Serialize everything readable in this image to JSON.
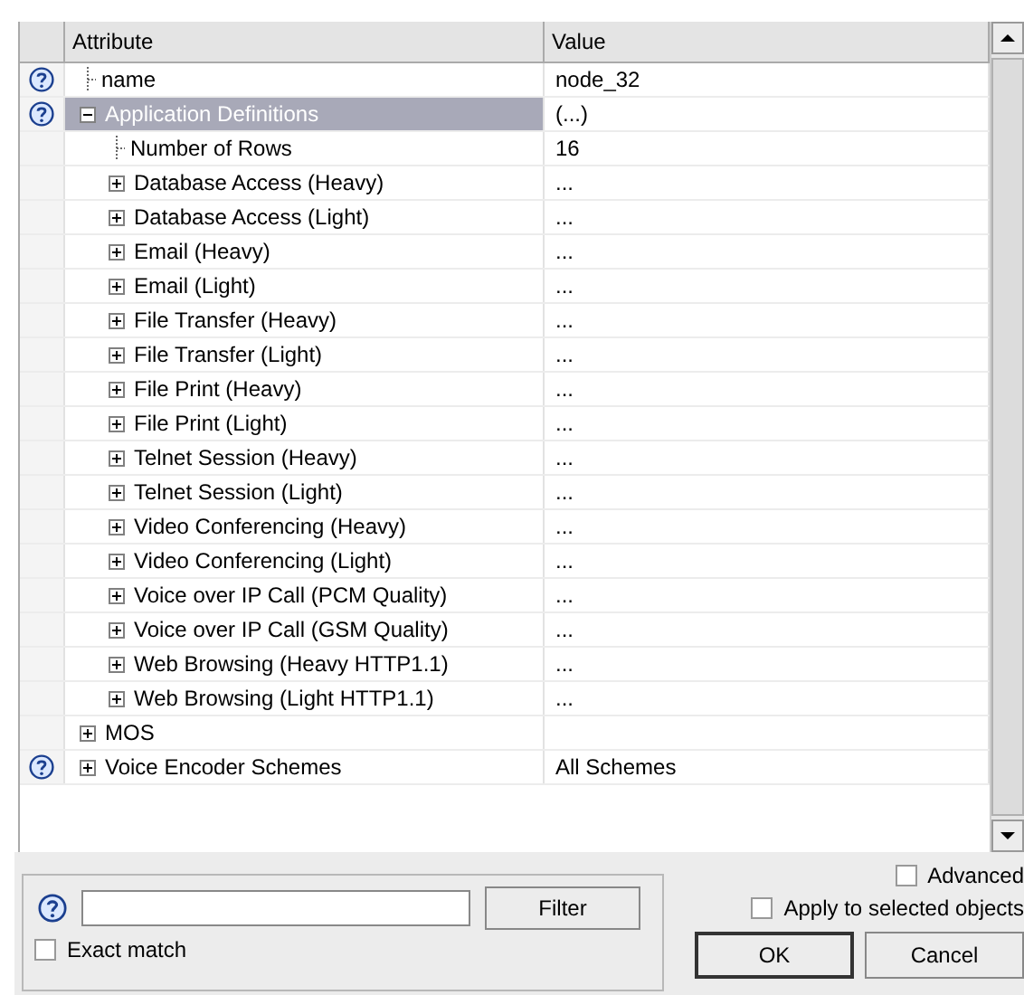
{
  "table": {
    "columns": [
      "Attribute",
      "Value"
    ],
    "rows": [
      {
        "name": "name",
        "value": "node_32",
        "help": true,
        "selected": false
      },
      {
        "name": "Application Definitions",
        "value": "(...)",
        "help": true,
        "selected": true,
        "expanded": true,
        "children": [
          {
            "name": "Number of Rows",
            "value": "16",
            "selected": false
          },
          {
            "name": "Database Access (Heavy)",
            "value": "...",
            "selected": false,
            "expanded": false
          },
          {
            "name": "Database Access (Light)",
            "value": "...",
            "selected": false,
            "expanded": false
          },
          {
            "name": "Email (Heavy)",
            "value": "...",
            "selected": false,
            "expanded": false
          },
          {
            "name": "Email (Light)",
            "value": "...",
            "selected": false,
            "expanded": false
          },
          {
            "name": "File Transfer (Heavy)",
            "value": "...",
            "selected": false,
            "expanded": false
          },
          {
            "name": "File Transfer (Light)",
            "value": "...",
            "selected": false,
            "expanded": false
          },
          {
            "name": "File Print (Heavy)",
            "value": "...",
            "selected": false,
            "expanded": false
          },
          {
            "name": "File Print (Light)",
            "value": "...",
            "selected": false,
            "expanded": false
          },
          {
            "name": "Telnet Session (Heavy)",
            "value": "...",
            "selected": false,
            "expanded": false
          },
          {
            "name": "Telnet Session (Light)",
            "value": "...",
            "selected": false,
            "expanded": false
          },
          {
            "name": "Video Conferencing (Heavy)",
            "value": "...",
            "selected": false,
            "expanded": false
          },
          {
            "name": "Video Conferencing (Light)",
            "value": "...",
            "selected": false,
            "expanded": false
          },
          {
            "name": "Voice over IP Call (PCM Quality)",
            "value": "...",
            "selected": false,
            "expanded": false
          },
          {
            "name": "Voice over IP Call (GSM Quality)",
            "value": "...",
            "selected": false,
            "expanded": false
          },
          {
            "name": "Web Browsing (Heavy HTTP1.1)",
            "value": "...",
            "selected": false,
            "expanded": false
          },
          {
            "name": "Web Browsing (Light HTTP1.1)",
            "value": "...",
            "selected": false,
            "expanded": false
          }
        ]
      },
      {
        "name": "MOS",
        "help": false,
        "selected": false,
        "expanded": false
      },
      {
        "name": "Voice Encoder Schemes",
        "value": "All Schemes",
        "help": true,
        "selected": false,
        "expanded": false
      }
    ]
  },
  "filter": {
    "button": "Filter",
    "exact_match": {
      "label": "Exact match",
      "checked": false
    }
  },
  "advanced": {
    "label": "Advanced",
    "checked": false
  },
  "apply_to_selected": {
    "label": "Apply to selected objects",
    "checked": false
  },
  "buttons": [
    "OK",
    "Cancel"
  ]
}
